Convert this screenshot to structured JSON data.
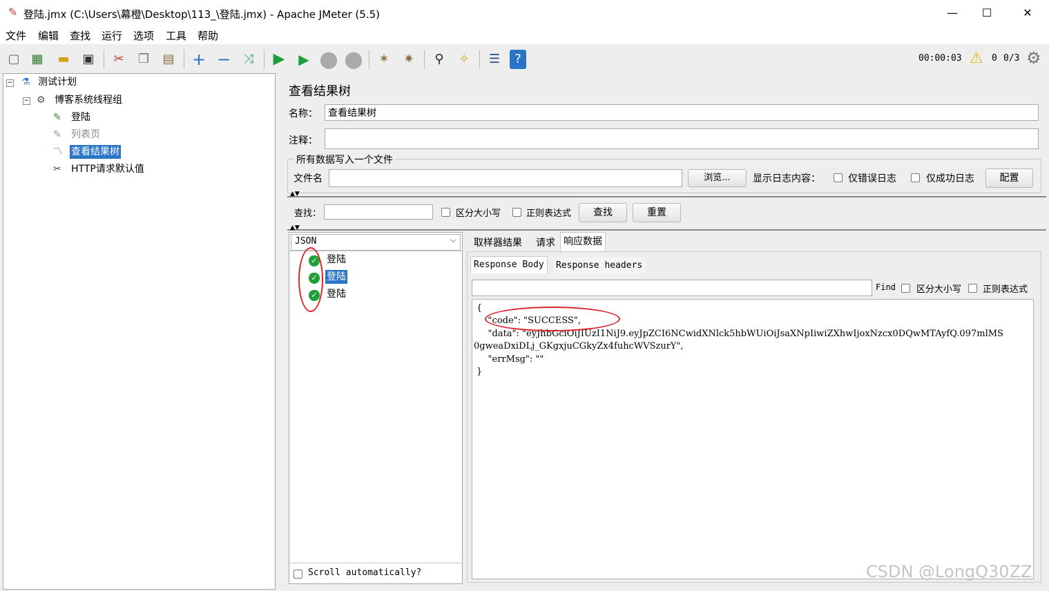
{
  "window": {
    "title": "登陆.jmx (C:\\Users\\幕橙\\Desktop\\113_\\登陆.jmx) - Apache JMeter (5.5)",
    "minimize": "—",
    "maximize": "☐",
    "close": "✕"
  },
  "menu": [
    "文件",
    "编辑",
    "查找",
    "运行",
    "选项",
    "工具",
    "帮助"
  ],
  "toolbar": {
    "timer": "00:00:03",
    "warning_count": "0",
    "threads": "0/3"
  },
  "tree": {
    "plan": "测试计划",
    "thread_group": "博客系统线程组",
    "sampler_login": "登陆",
    "sampler_list": "列表页",
    "listener": "查看结果树",
    "defaults": "HTTP请求默认值"
  },
  "panel": {
    "title": "查看结果树",
    "name_label": "名称：",
    "name_value": "查看结果树",
    "comment_label": "注释：",
    "comment_value": "",
    "file_group_label": "所有数据写入一个文件",
    "filename_label": "文件名",
    "filename_value": "",
    "browse_button": "浏览...",
    "log_label": "显示日志内容：",
    "errors_only": "仅错误日志",
    "success_only": "仅成功日志",
    "config_button": "配置",
    "search_label": "查找：",
    "search_value": "",
    "case_sensitive": "区分大小写",
    "regex": "正则表达式",
    "find_button": "查找",
    "reset_button": "重置"
  },
  "results": {
    "renderer": "JSON",
    "items": [
      "登陆",
      "登陆",
      "登陆"
    ],
    "selected_index": 1,
    "scroll_auto": "Scroll automatically?"
  },
  "detail": {
    "tabs": [
      "取样器结果",
      "请求",
      "响应数据"
    ],
    "active_tab": "响应数据",
    "subtabs": [
      "Response Body",
      "Response headers"
    ],
    "find_label": "Find",
    "find_case": "区分大小写",
    "find_regex": "正则表达式",
    "body_lines": [
      "{",
      "    \"code\": \"SUCCESS\",",
      "    \"data\": \"eyJhbGciOiJIUzI1NiJ9.eyJpZCI6NCwidXNlck5hbWUiOiJsaXNpIiwiZXhwIjoxNzcx0DQwMTAyfQ.097mlMS",
      "0gweaDxiDLj_GKgxjuCGkyZx4fuhcWVSzurY\",",
      "    \"errMsg\": \"\"",
      "}"
    ]
  },
  "watermark": "CSDN @LongQ30ZZ"
}
